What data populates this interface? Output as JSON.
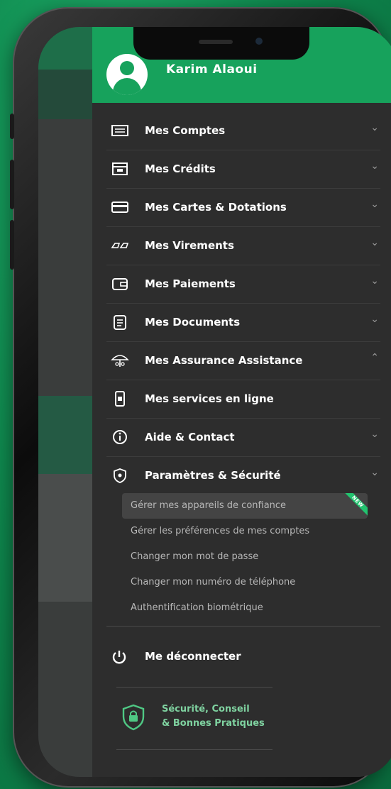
{
  "user": {
    "name": "Karim Alaoui"
  },
  "menu": {
    "items": [
      {
        "label": "Mes Comptes",
        "icon": "account-list-icon",
        "chevron": "⌄"
      },
      {
        "label": "Mes Crédits",
        "icon": "credit-box-icon",
        "chevron": "⌄"
      },
      {
        "label": "Mes Cartes & Dotations",
        "icon": "card-icon",
        "chevron": "⌄"
      },
      {
        "label": "Mes Virements",
        "icon": "transfer-icon",
        "chevron": "⌄"
      },
      {
        "label": "Mes Paiements",
        "icon": "wallet-icon",
        "chevron": "⌄"
      },
      {
        "label": "Mes Documents",
        "icon": "document-icon",
        "chevron": "⌄"
      },
      {
        "label": "Mes Assurance Assistance",
        "icon": "umbrella-icon",
        "chevron": "⌃"
      },
      {
        "label": "Mes services en ligne",
        "icon": "phone-service-icon",
        "chevron": ""
      },
      {
        "label": "Aide & Contact",
        "icon": "info-icon",
        "chevron": "⌄"
      },
      {
        "label": "Paramètres & Sécurité",
        "icon": "shield-settings-icon",
        "chevron": "⌄"
      }
    ],
    "sub_items": [
      {
        "label": "Gérer mes appareils de confiance",
        "badge": "NEW"
      },
      {
        "label": "Gérer les préférences de mes comptes"
      },
      {
        "label": "Changer mon mot de passe"
      },
      {
        "label": "Changer mon numéro de téléphone"
      },
      {
        "label": "Authentification biométrique"
      }
    ],
    "logout": "Me déconnecter",
    "security_line1": "Sécurité, Conseil",
    "security_line2": "& Bonnes Pratiques"
  },
  "colors": {
    "brand_green": "#17a25c",
    "drawer_bg": "#2d2d2d",
    "accent_text": "#7fd2a0"
  }
}
